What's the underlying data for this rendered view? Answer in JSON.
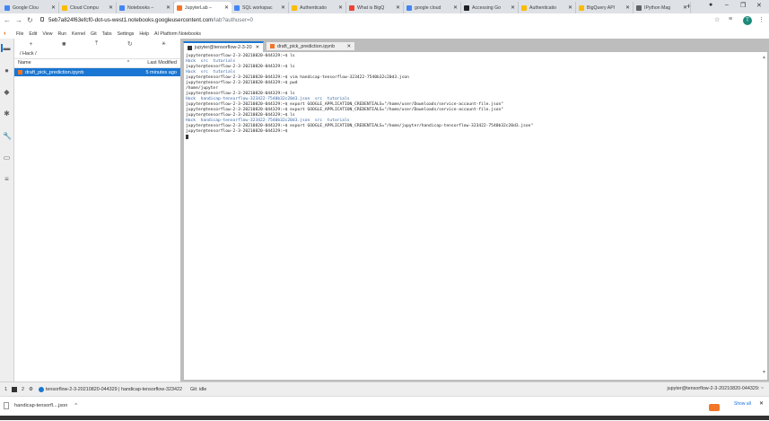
{
  "browser": {
    "tabs": [
      {
        "title": "Google Clou",
        "color": "#4285f4"
      },
      {
        "title": "Cloud Compu",
        "color": "#fbbc04"
      },
      {
        "title": "Notebooks –",
        "color": "#4285f4"
      },
      {
        "title": "JupyterLab –",
        "color": "#f37626"
      },
      {
        "title": "SQL workspac",
        "color": "#4285f4"
      },
      {
        "title": "Authenticatio",
        "color": "#fbbc04"
      },
      {
        "title": "What is BigQ",
        "color": "#ea4335"
      },
      {
        "title": "google cloud",
        "color": "#4285f4"
      },
      {
        "title": "Accessing Go",
        "color": "#202124"
      },
      {
        "title": "Authenticatio",
        "color": "#fbbc04"
      },
      {
        "title": "BigQuery API",
        "color": "#fbbc04"
      },
      {
        "title": "IPython Mag",
        "color": "#5f6368"
      }
    ],
    "active_tab_index": 3,
    "url_main": "5eb7a824f63efcf0-dot-us-west1.notebooks.googleusercontent.com",
    "url_path": "/lab?authuser=0",
    "avatar_letter": "T"
  },
  "menubar": {
    "items": [
      "File",
      "Edit",
      "View",
      "Run",
      "Kernel",
      "Git",
      "Tabs",
      "Settings",
      "Help",
      "AI Platform Notebooks"
    ]
  },
  "filebrowser": {
    "breadcrumb": "/ Hack /",
    "col_name": "Name",
    "col_modified": "Last Modified",
    "files": [
      {
        "name": "draft_pick_prediction.ipynb",
        "modified": "5 minutes ago"
      }
    ]
  },
  "doc_tabs": [
    {
      "label": "jupyter@tensorflow-2-3-20(",
      "active": true
    },
    {
      "label": "draft_pick_prediction.ipynb",
      "active": false
    }
  ],
  "terminal": {
    "lines": [
      {
        "text": "jupyter@tensorflow-2-3-20210820-044329:~$ ls",
        "blue": false
      },
      {
        "text": "Hack  src  tutorials",
        "blue": true
      },
      {
        "text": "jupyter@tensorflow-2-3-20210820-044329:~$ ls",
        "blue": false
      },
      {
        "text": "Hack  src  tutorials",
        "blue": true
      },
      {
        "text": "jupyter@tensorflow-2-3-20210820-044329:~$ vim handicap-tensorflow-323422-7540b32c20d3.json",
        "blue": false
      },
      {
        "text": "jupyter@tensorflow-2-3-20210820-044329:~$ pwd",
        "blue": false
      },
      {
        "text": "/home/jupyter",
        "blue": false
      },
      {
        "text": "jupyter@tensorflow-2-3-20210820-044329:~$ ls",
        "blue": false
      },
      {
        "text": "Hack  handicap-tensorflow-323422-7540b32c20d3.json  src  tutorials",
        "blue": true
      },
      {
        "text": "jupyter@tensorflow-2-3-20210820-044329:~$ export GOOGLE_APPLICATION_CREDENTIALS=\"/home/user/Downloads/service-account-file.json\"",
        "blue": false
      },
      {
        "text": "jupyter@tensorflow-2-3-20210820-044329:~$ export GOOGLE_APPLICATION_CREDENTIALS=\"/home/user/Downloads/service-account-file.json\"",
        "blue": false
      },
      {
        "text": "jupyter@tensorflow-2-3-20210820-044329:~$ ls",
        "blue": false
      },
      {
        "text": "Hack  handicap-tensorflow-323422-7540b32c20d3.json  src  tutorials",
        "blue": true
      },
      {
        "text": "jupyter@tensorflow-2-3-20210820-044329:~$ export GOOGLE_APPLICATION_CREDENTIALS=\"/home/jupyter/handicap-tensorflow-323422-7540b32c20d3.json\"",
        "blue": false
      },
      {
        "text": "jupyter@tensorflow-2-3-20210820-044329:~$",
        "blue": false
      }
    ]
  },
  "statusbar": {
    "count1": "1",
    "count2": "2",
    "kernel_text": "tensorflow-2-3-20210820-044329 | handicap-tensorflow-323422",
    "git_status": "Git: idle",
    "right_text": "jupyter@tensorflow-2-3-20210820-044329: ~"
  },
  "downloads": {
    "file_label": "handicap-tensorfl....json",
    "show_all": "Show all"
  }
}
